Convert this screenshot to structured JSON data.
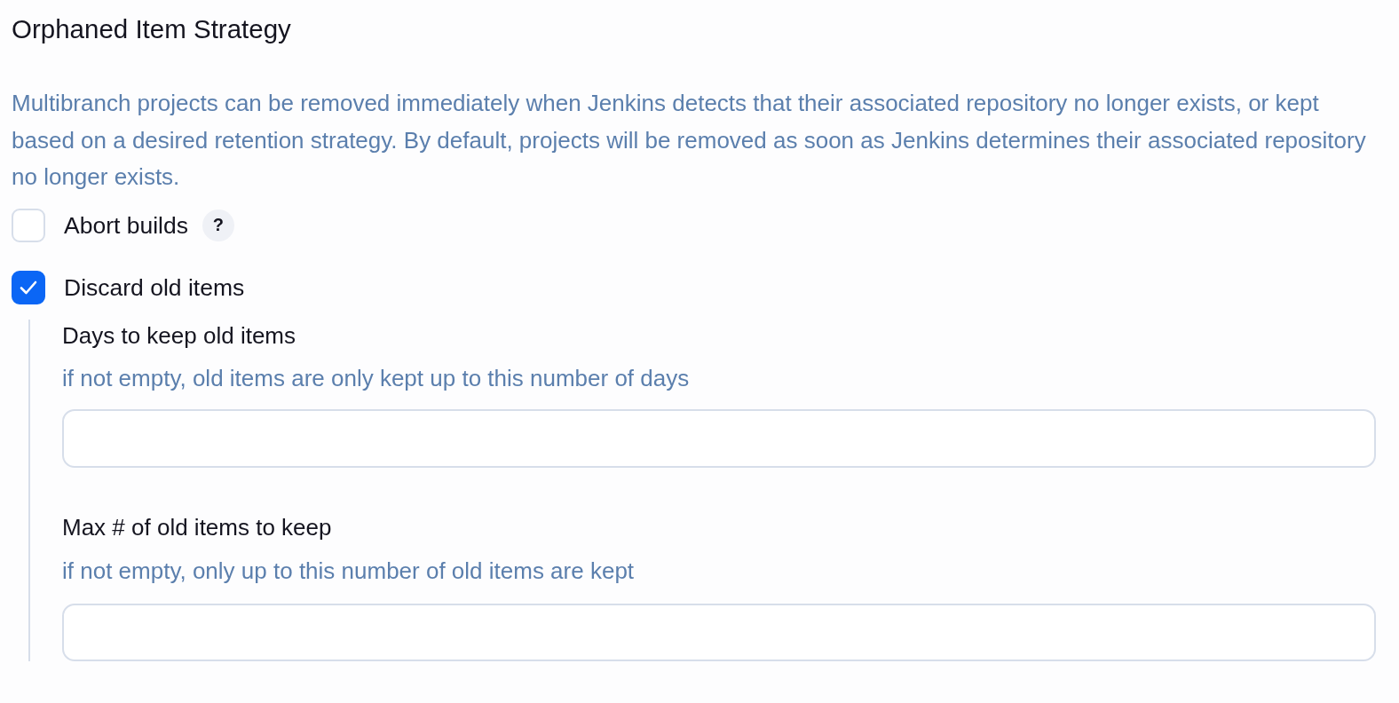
{
  "section": {
    "title": "Orphaned Item Strategy",
    "description": "Multibranch projects can be removed immediately when Jenkins detects that their associated repository no longer exists, or kept based on a desired retention strategy. By default, projects will be removed as soon as Jenkins determines their associated repository no longer exists."
  },
  "options": [
    {
      "label": "Abort builds",
      "checked": false,
      "help": "?"
    },
    {
      "label": "Discard old items",
      "checked": true,
      "fields": [
        {
          "label": "Days to keep old items",
          "hint": "if not empty, old items are only kept up to this number of days"
        },
        {
          "label": "Max # of old items to keep",
          "hint": "if not empty, only up to this number of old items are kept"
        }
      ]
    }
  ]
}
